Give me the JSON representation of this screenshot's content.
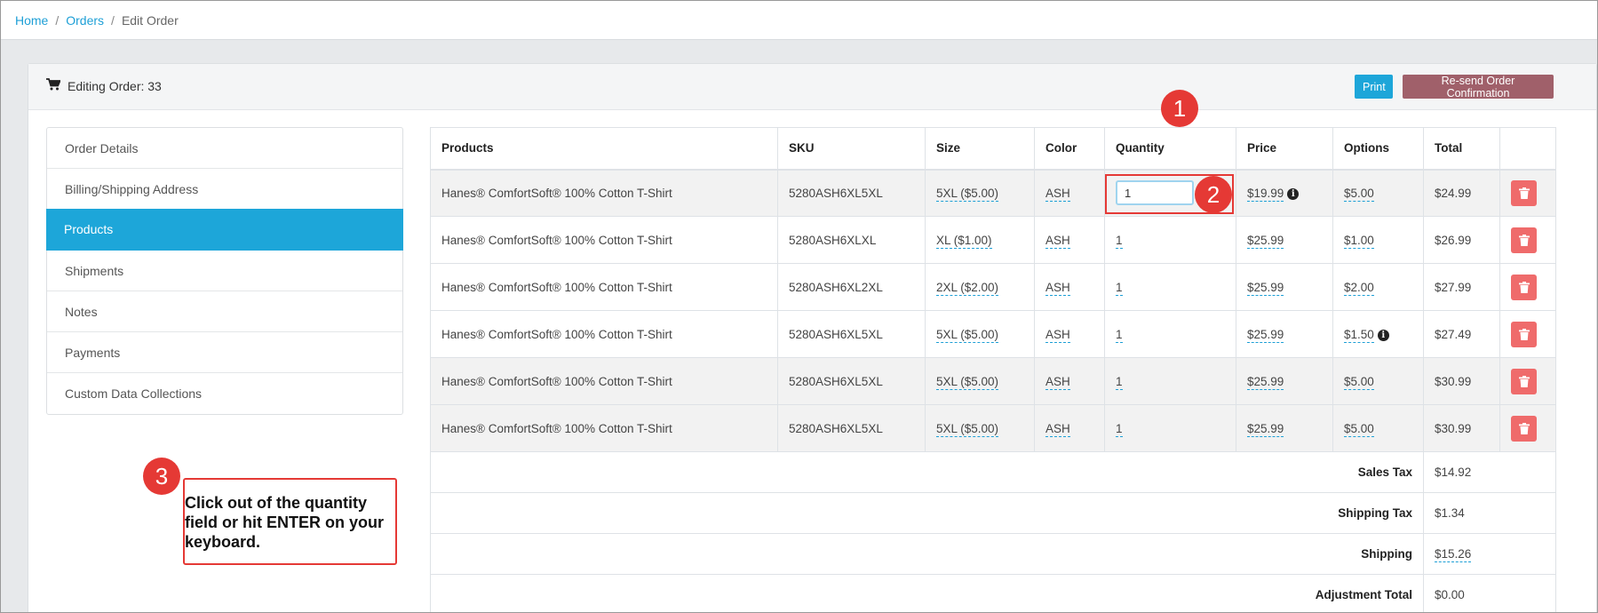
{
  "breadcrumb": {
    "home": "Home",
    "orders": "Orders",
    "current": "Edit Order"
  },
  "header": {
    "title": "Editing Order: 33",
    "print": "Print",
    "resend": "Re-send Order Confirmation"
  },
  "sidebar": {
    "items": [
      {
        "label": "Order Details"
      },
      {
        "label": "Billing/Shipping Address"
      },
      {
        "label": "Products"
      },
      {
        "label": "Shipments"
      },
      {
        "label": "Notes"
      },
      {
        "label": "Payments"
      },
      {
        "label": "Custom Data Collections"
      }
    ]
  },
  "table": {
    "columns": [
      "Products",
      "SKU",
      "Size",
      "Color",
      "Quantity",
      "Price",
      "Options",
      "Total"
    ],
    "rows": [
      {
        "product": "Hanes® ComfortSoft® 100% Cotton T-Shirt",
        "sku": "5280ASH6XL5XL",
        "size": "5XL ($5.00)",
        "color": "ASH",
        "quantity": "1",
        "price": "$19.99",
        "options": "$5.00",
        "total": "$24.99"
      },
      {
        "product": "Hanes® ComfortSoft® 100% Cotton T-Shirt",
        "sku": "5280ASH6XLXL",
        "size": "XL ($1.00)",
        "color": "ASH",
        "quantity": "1",
        "price": "$25.99",
        "options": "$1.00",
        "total": "$26.99"
      },
      {
        "product": "Hanes® ComfortSoft® 100% Cotton T-Shirt",
        "sku": "5280ASH6XL2XL",
        "size": "2XL ($2.00)",
        "color": "ASH",
        "quantity": "1",
        "price": "$25.99",
        "options": "$2.00",
        "total": "$27.99"
      },
      {
        "product": "Hanes® ComfortSoft® 100% Cotton T-Shirt",
        "sku": "5280ASH6XL5XL",
        "size": "5XL ($5.00)",
        "color": "ASH",
        "quantity": "1",
        "price": "$25.99",
        "options": "$1.50",
        "total": "$27.49"
      },
      {
        "product": "Hanes® ComfortSoft® 100% Cotton T-Shirt",
        "sku": "5280ASH6XL5XL",
        "size": "5XL ($5.00)",
        "color": "ASH",
        "quantity": "1",
        "price": "$25.99",
        "options": "$5.00",
        "total": "$30.99"
      },
      {
        "product": "Hanes® ComfortSoft® 100% Cotton T-Shirt",
        "sku": "5280ASH6XL5XL",
        "size": "5XL ($5.00)",
        "color": "ASH",
        "quantity": "1",
        "price": "$25.99",
        "options": "$5.00",
        "total": "$30.99"
      }
    ],
    "summary": [
      {
        "label": "Sales Tax",
        "value": "$14.92"
      },
      {
        "label": "Shipping Tax",
        "value": "$1.34"
      },
      {
        "label": "Shipping",
        "value": "$15.26"
      },
      {
        "label": "Adjustment Total",
        "value": "$0.00"
      }
    ]
  },
  "annotations": {
    "step1": "1",
    "step2": "2",
    "step3": "3",
    "callout": "Click out of the quantity field or hit ENTER on your keyboard."
  },
  "colors": {
    "accent": "#1da6d9",
    "danger": "#ef6b6b",
    "resend": "#a0606a",
    "annotation": "#e53935"
  }
}
